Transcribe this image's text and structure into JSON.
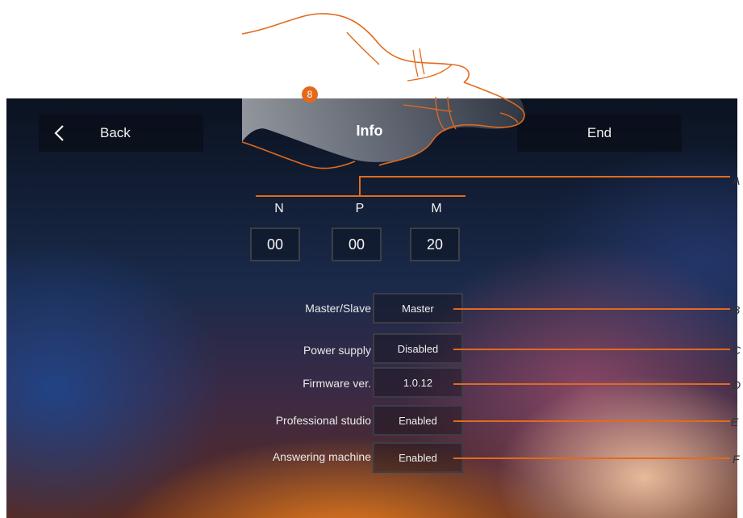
{
  "topbar": {
    "back_label": "Back",
    "title": "Info",
    "end_label": "End"
  },
  "address": {
    "columns": [
      {
        "label": "N",
        "value": "00"
      },
      {
        "label": "P",
        "value": "00"
      },
      {
        "label": "M",
        "value": "20"
      }
    ]
  },
  "settings": [
    {
      "label": "Master/Slave",
      "value": "Master"
    },
    {
      "label": "Power supply",
      "value": "Disabled"
    },
    {
      "label": "Firmware ver.",
      "value": "1.0.12"
    },
    {
      "label": "Professional studio",
      "value": "Enabled"
    },
    {
      "label": "Answering machine",
      "value": "Enabled"
    }
  ],
  "callouts": [
    "A",
    "B",
    "C",
    "D",
    "E",
    "F"
  ],
  "step_badge": "8",
  "colors": {
    "accent": "#e36a1b",
    "button_bg": "#0a0e18"
  }
}
